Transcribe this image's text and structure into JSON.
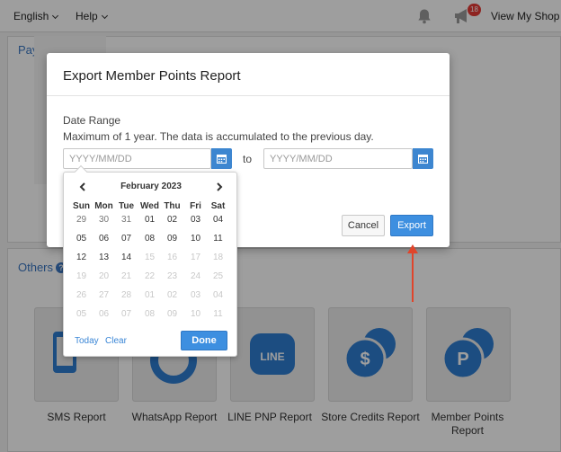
{
  "topbar": {
    "language": "English",
    "help": "Help",
    "notification_count": "18",
    "view_shop": "View My Shop",
    "icons": [
      "bell-icon",
      "megaphone-icon"
    ]
  },
  "background": {
    "payments_title": "Payments",
    "others_title": "Others",
    "cards": [
      {
        "label": "SMS Report",
        "icon": "phone-icon"
      },
      {
        "label": "WhatsApp Report",
        "icon": "whatsapp-icon"
      },
      {
        "label": "LINE PNP Report",
        "icon": "line-icon"
      },
      {
        "label": "Store Credits Report",
        "icon": "dollar-coin-icon"
      },
      {
        "label": "Member Points Report",
        "icon": "points-coin-icon"
      }
    ]
  },
  "modal": {
    "title": "Export Member Points Report",
    "date_range_label": "Date Range",
    "max_note": "Maximum of 1 year. The data is accumulated to the previous day.",
    "start_placeholder": "YYYY/MM/DD",
    "end_placeholder": "YYYY/MM/DD",
    "to_label": "to",
    "cancel_label": "Cancel",
    "export_label": "Export"
  },
  "datepicker": {
    "month_label": "February 2023",
    "weekdays": [
      "Sun",
      "Mon",
      "Tue",
      "Wed",
      "Thu",
      "Fri",
      "Sat"
    ],
    "weeks": [
      [
        {
          "d": "29",
          "s": "other"
        },
        {
          "d": "30",
          "s": "other"
        },
        {
          "d": "31",
          "s": "other"
        },
        {
          "d": "01",
          "s": "cur"
        },
        {
          "d": "02",
          "s": "cur"
        },
        {
          "d": "03",
          "s": "cur"
        },
        {
          "d": "04",
          "s": "cur"
        }
      ],
      [
        {
          "d": "05",
          "s": "cur"
        },
        {
          "d": "06",
          "s": "cur"
        },
        {
          "d": "07",
          "s": "cur"
        },
        {
          "d": "08",
          "s": "cur"
        },
        {
          "d": "09",
          "s": "cur"
        },
        {
          "d": "10",
          "s": "cur"
        },
        {
          "d": "11",
          "s": "cur"
        }
      ],
      [
        {
          "d": "12",
          "s": "cur"
        },
        {
          "d": "13",
          "s": "cur"
        },
        {
          "d": "14",
          "s": "cur"
        },
        {
          "d": "15",
          "s": "disabled"
        },
        {
          "d": "16",
          "s": "disabled"
        },
        {
          "d": "17",
          "s": "disabled"
        },
        {
          "d": "18",
          "s": "disabled"
        }
      ],
      [
        {
          "d": "19",
          "s": "disabled"
        },
        {
          "d": "20",
          "s": "disabled"
        },
        {
          "d": "21",
          "s": "disabled"
        },
        {
          "d": "22",
          "s": "disabled"
        },
        {
          "d": "23",
          "s": "disabled"
        },
        {
          "d": "24",
          "s": "disabled"
        },
        {
          "d": "25",
          "s": "disabled"
        }
      ],
      [
        {
          "d": "26",
          "s": "disabled"
        },
        {
          "d": "27",
          "s": "disabled"
        },
        {
          "d": "28",
          "s": "disabled"
        },
        {
          "d": "01",
          "s": "disabled"
        },
        {
          "d": "02",
          "s": "disabled"
        },
        {
          "d": "03",
          "s": "disabled"
        },
        {
          "d": "04",
          "s": "disabled"
        }
      ],
      [
        {
          "d": "05",
          "s": "disabled"
        },
        {
          "d": "06",
          "s": "disabled"
        },
        {
          "d": "07",
          "s": "disabled"
        },
        {
          "d": "08",
          "s": "disabled"
        },
        {
          "d": "09",
          "s": "disabled"
        },
        {
          "d": "10",
          "s": "disabled"
        },
        {
          "d": "11",
          "s": "disabled"
        }
      ]
    ],
    "today_label": "Today",
    "clear_label": "Clear",
    "done_label": "Done"
  },
  "colors": {
    "accent": "#3d8fe0",
    "link": "#3a77c2",
    "annotation_arrow": "#e0452b",
    "badge": "#e53935"
  }
}
